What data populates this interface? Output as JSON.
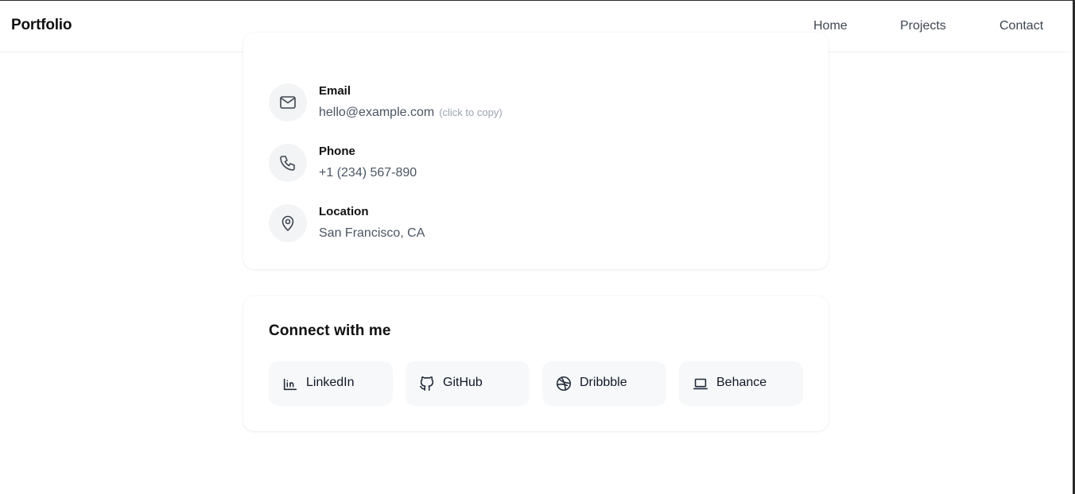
{
  "header": {
    "brand": "Portfolio",
    "nav": [
      "Home",
      "Projects",
      "Contact"
    ]
  },
  "contact_info": {
    "items": [
      {
        "icon": "mail-icon",
        "label": "Email",
        "value": "hello@example.com",
        "hint": "(click to copy)"
      },
      {
        "icon": "phone-icon",
        "label": "Phone",
        "value": "+1 (234) 567-890"
      },
      {
        "icon": "map-pin-icon",
        "label": "Location",
        "value": "San Francisco, CA"
      }
    ]
  },
  "social": {
    "title": "Connect with me",
    "links": [
      {
        "icon": "linkedin-icon",
        "label": "LinkedIn"
      },
      {
        "icon": "github-icon",
        "label": "GitHub"
      },
      {
        "icon": "dribbble-icon",
        "label": "Dribbble"
      },
      {
        "icon": "laptop-icon",
        "label": "Behance"
      }
    ]
  },
  "colors": {
    "text": "#111111",
    "muted": "#4b5563",
    "hint": "#9ca3af",
    "icon_bg": "#f3f4f6",
    "button_bg": "#f7f8fa"
  }
}
